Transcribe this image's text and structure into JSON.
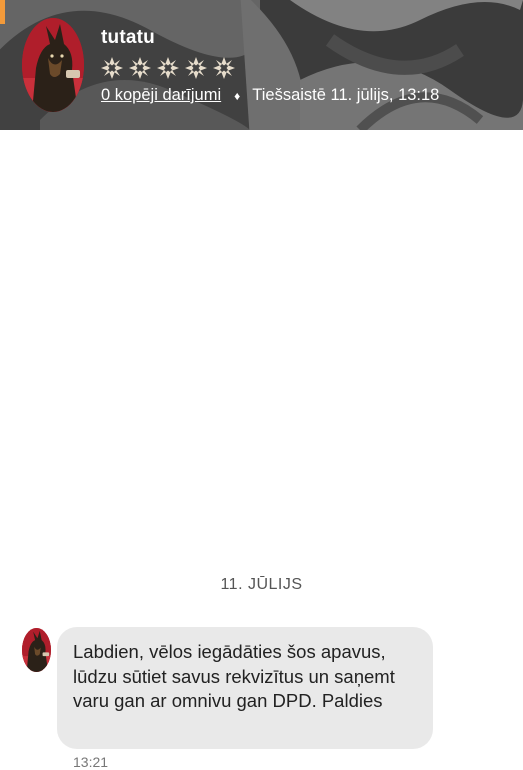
{
  "profile": {
    "username": "tutatu",
    "rating_stars": 5,
    "transactions_link": "0 kopēji darījumi",
    "separator": "♦",
    "online_status": "Tiešsaistē 11. jūlijs, 13:18"
  },
  "chat": {
    "date_separator": "11. JŪLIJS",
    "messages": [
      {
        "text": "Labdien, vēlos iegādāties šos apavus, lūdzu sūtiet savus rekvizītus un saņemt varu gan ar omnivu  gan DPD. Paldies",
        "time": "13:21"
      }
    ]
  },
  "colors": {
    "accent_orange": "#f39a3a",
    "bubble_bg": "#e9e9e9",
    "star_fill": "#e6dccb"
  }
}
